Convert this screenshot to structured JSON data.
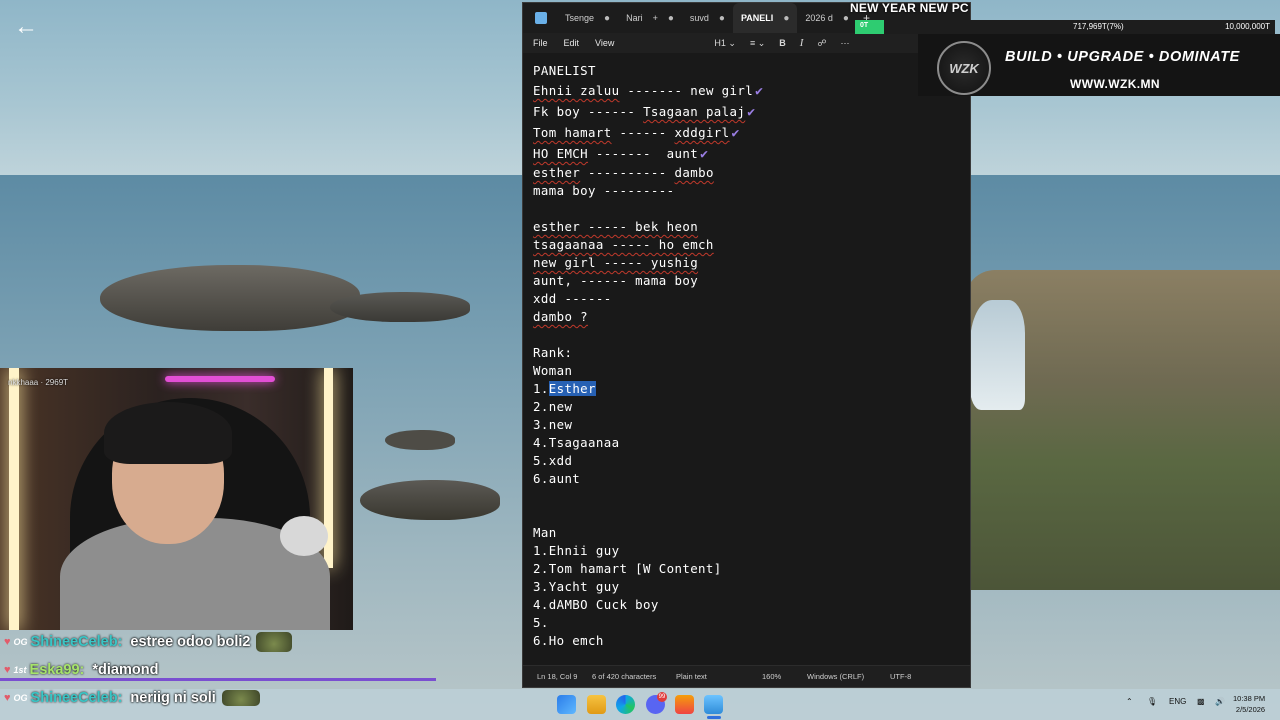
{
  "background": {
    "scene": "seaside with rocks"
  },
  "nav": {
    "back_icon": "arrow-left-icon"
  },
  "notepad": {
    "tabs": [
      {
        "label": "Tsenge",
        "active": false
      },
      {
        "label": "Nari",
        "active": false,
        "mark": "+"
      },
      {
        "label": "suvd",
        "active": false
      },
      {
        "label": "PANELI",
        "active": true
      },
      {
        "label": "2026 d",
        "active": false
      }
    ],
    "menu": {
      "file": "File",
      "edit": "Edit",
      "view": "View",
      "heading": "H1"
    },
    "content": {
      "title": "PANELIST",
      "pairs_top": [
        {
          "a": "Ehnii zaluu",
          "sep": " ------- ",
          "b": "new girl",
          "check": true
        },
        {
          "a": "Fk boy",
          "sep": " ------ ",
          "b": "Tsagaan palaj",
          "check": true
        },
        {
          "a": "Tom hamart",
          "sep": " ------ ",
          "b": "xddgirl",
          "check": true
        },
        {
          "a": "HO EMCH",
          "sep": " -------  ",
          "b": "aunt",
          "check": true
        },
        {
          "a": "esther",
          "sep": " ---------- ",
          "b": "dambo",
          "check": false
        },
        {
          "a": "mama boy",
          "sep": " ---------",
          "b": "",
          "check": false
        }
      ],
      "pairs_bottom": [
        "esther ----- bek heon",
        "tsagaanaa ----- ho emch",
        "new girl ----- yushig",
        "aunt, ------ mama boy",
        "xdd ------",
        "dambo ?"
      ],
      "rank_label": "Rank:",
      "woman_label": "Woman",
      "woman_first_prefix": "1.",
      "woman_first_selected": "Esther",
      "woman_rest": [
        "2.new",
        "3.new",
        "4.Tsagaanaa",
        "5.xdd",
        "6.aunt"
      ],
      "man_label": "Man",
      "man_list": [
        "1.Ehnii guy",
        "2.Tom hamart [W Content]",
        "3.Yacht guy",
        "4.dAMBO Cuck boy",
        "5.",
        "6.Ho emch"
      ]
    },
    "status": {
      "position": "Ln 18, Col 9",
      "chars": "6 of 420 characters",
      "format": "Plain text",
      "zoom": "160%",
      "line_endings": "Windows (CRLF)",
      "encoding": "UTF-8"
    }
  },
  "overlay": {
    "goal_title": "NEW YEAR NEW PC",
    "goal_start": "0T",
    "goal_current": "717,969T(7%)",
    "goal_target": "10,000,000T",
    "goal_progress": 0.07,
    "banner_logo": "WZK",
    "banner_tagline": "BUILD • UPGRADE • DOMINATE",
    "banner_url": "WWW.WZK.MN"
  },
  "webcam": {
    "label": "nkkhaaa · 2969T"
  },
  "chat": [
    {
      "badge": "OG",
      "user": "ShineeCeleb:",
      "message": "estree odoo boli2",
      "emote": true
    },
    {
      "badge": "1st",
      "user": "Eska99:",
      "message": "*diamond",
      "emote": false
    },
    {
      "badge": "OG",
      "user": "ShineeCeleb:",
      "message": "neriig ni soli",
      "emote": true
    }
  ],
  "taskbar": {
    "discord_badge": "99",
    "lang": "ENG",
    "time": "10:38 PM",
    "date": "2/5/2026"
  },
  "colors": {
    "accent_check": "#9a7ee3",
    "selection": "#2761b4",
    "goal_fill": "#2ecc71"
  }
}
